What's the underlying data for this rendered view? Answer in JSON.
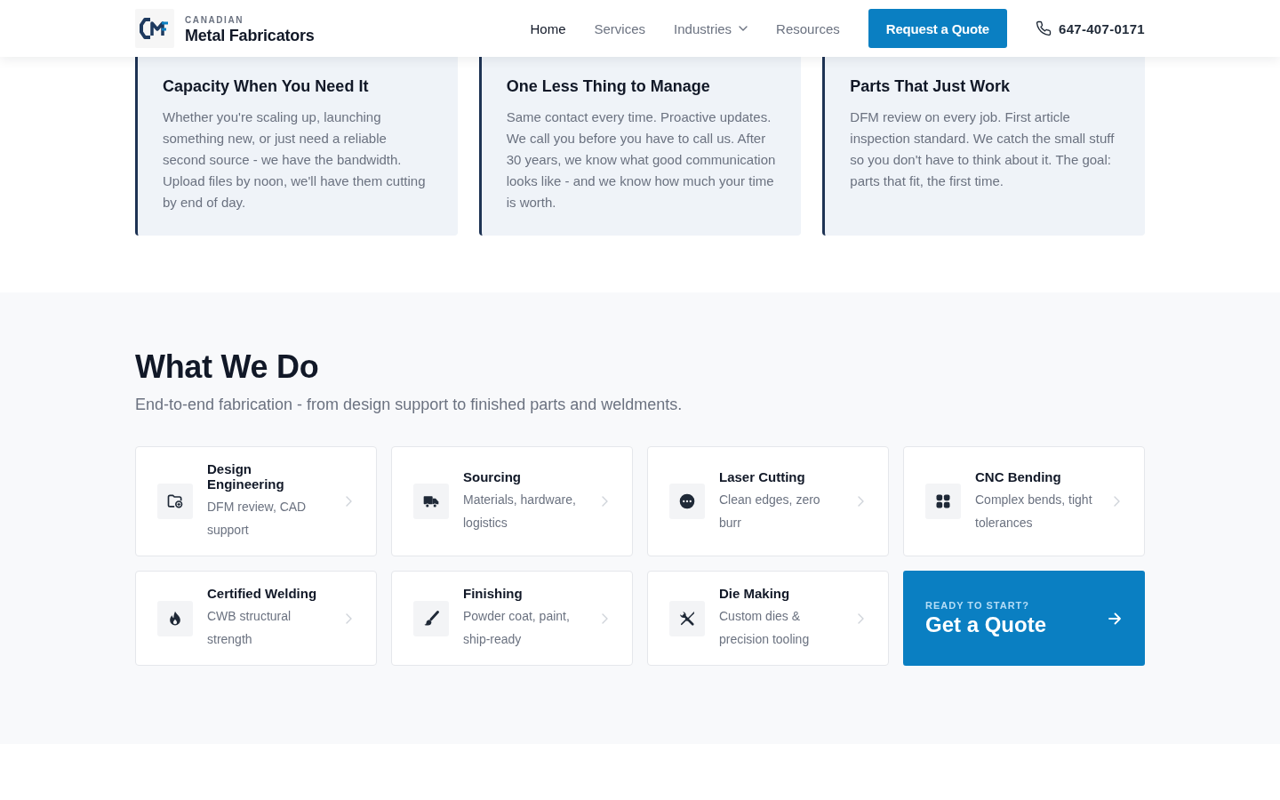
{
  "header": {
    "logo": {
      "tagline": "CANADIAN",
      "name": "Metal Fabricators"
    },
    "nav": [
      {
        "label": "Home",
        "selected": true,
        "has_menu": false
      },
      {
        "label": "Services",
        "selected": false,
        "has_menu": false
      },
      {
        "label": "Industries",
        "selected": false,
        "has_menu": true
      },
      {
        "label": "Resources",
        "selected": false,
        "has_menu": false
      }
    ],
    "quote_button": "Request a Quote",
    "phone": "647-407-0171"
  },
  "features": [
    {
      "title": "Capacity When You Need It",
      "body": "Whether you're scaling up, launching something new, or just need a reliable second source - we have the bandwidth. Upload files by noon, we'll have them cutting by end of day."
    },
    {
      "title": "One Less Thing to Manage",
      "body": "Same contact every time. Proactive updates. We call you before you have to call us. After 30 years, we know what good communication looks like - and we know how much your time is worth."
    },
    {
      "title": "Parts That Just Work",
      "body": "DFM review on every job. First article inspection standard. We catch the small stuff so you don't have to think about it. The goal: parts that fit, the first time."
    }
  ],
  "services_section": {
    "heading": "What We Do",
    "subheading": "End-to-end fabrication - from design support to finished parts and weldments.",
    "services": [
      {
        "title": "Design Engineering",
        "description": "DFM review, CAD support"
      },
      {
        "title": "Sourcing",
        "description": "Materials, hardware, logistics"
      },
      {
        "title": "Laser Cutting",
        "description": "Clean edges, zero burr"
      },
      {
        "title": "CNC Bending",
        "description": "Complex bends, tight tolerances"
      },
      {
        "title": "Certified Welding",
        "description": "CWB structural strength"
      },
      {
        "title": "Finishing",
        "description": "Powder coat, paint, ship-ready"
      },
      {
        "title": "Die Making",
        "description": "Custom dies & precision tooling"
      }
    ],
    "cta": {
      "eyebrow": "READY TO START?",
      "title": "Get a Quote"
    }
  }
}
